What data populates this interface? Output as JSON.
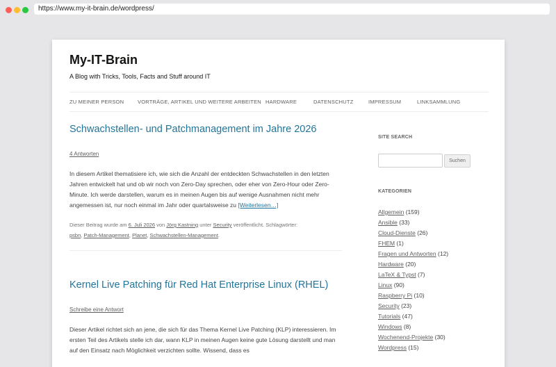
{
  "browser": {
    "url": "https://www.my-it-brain.de/wordpress/"
  },
  "site": {
    "title": "My-IT-Brain",
    "description": "A Blog with Tricks, Tools, Facts and Stuff around IT"
  },
  "nav": [
    {
      "label": "ZU MEINER PERSON"
    },
    {
      "label": "VORTRÄGE, ARTIKEL UND WEITERE ARBEITEN"
    },
    {
      "label": "HARDWARE"
    },
    {
      "label": "DATENSCHUTZ"
    },
    {
      "label": "IMPRESSUM"
    },
    {
      "label": "LINKSAMMLUNG"
    }
  ],
  "posts": [
    {
      "title": "Schwachstellen- und Patchmanagement im Jahre 2026",
      "comments": "4 Antworten",
      "excerpt": "In diesem Artikel thematisiere ich, wie sich die Anzahl der entdeckten Schwachstellen in den letzten Jahren entwickelt hat und ob wir noch von Zero-Day sprechen, oder eher von Zero-Hour oder Zero-Minute. Ich werde darstellen, warum es in meinen Augen bis auf wenige Ausnahmen nicht mehr angemessen ist, nur noch einmal im Jahr oder quartalsweise zu",
      "more": "[Weiterlesen…]",
      "meta": {
        "prefix": "Dieser Beitrag wurde am",
        "date": "6. Juli 2026",
        "by": "von",
        "author": "Jörg Kastning",
        "in": "unter",
        "category": "Security",
        "published": "veröffentlicht. Schlagwörter:",
        "tags": [
          "psbn",
          "Patch-Management",
          "Planet",
          "Schwachstellen-Management"
        ],
        "end": "."
      }
    },
    {
      "title": "Kernel Live Patching für Red Hat Enterprise Linux (RHEL)",
      "comments": "Schreibe eine Antwort",
      "excerpt": "Dieser Artikel richtet sich an jene, die sich für das Thema Kernel Live Patching (KLP) interessieren. Im ersten Teil des Artikels stelle ich dar, wann KLP in meinen Augen keine gute Lösung darstellt und man auf den Einsatz nach Möglichkeit verzichten sollte. Wissend, dass es"
    }
  ],
  "sidebar": {
    "search": {
      "title": "SITE SEARCH",
      "button": "Suchen",
      "placeholder": ""
    },
    "categories": {
      "title": "KATEGORIEN",
      "items": [
        {
          "name": "Allgemein",
          "count": "(159)"
        },
        {
          "name": "Ansible",
          "count": "(33)"
        },
        {
          "name": "Cloud-Dienste",
          "count": "(26)"
        },
        {
          "name": "FHEM",
          "count": "(1)"
        },
        {
          "name": "Fragen und Antworten",
          "count": "(12)"
        },
        {
          "name": "Hardware",
          "count": "(20)"
        },
        {
          "name": "LaTeX & Typst",
          "count": "(7)"
        },
        {
          "name": "Linux",
          "count": "(90)"
        },
        {
          "name": "Raspberry Pi",
          "count": "(10)"
        },
        {
          "name": "Security",
          "count": "(23)"
        },
        {
          "name": "Tutorials",
          "count": "(47)"
        },
        {
          "name": "Windows",
          "count": "(8)"
        },
        {
          "name": "Wochenend-Projekte",
          "count": "(30)"
        },
        {
          "name": "Wordpress",
          "count": "(15)"
        }
      ]
    }
  },
  "colors": {
    "link": "#21759b",
    "background": "#e6e5e8"
  }
}
